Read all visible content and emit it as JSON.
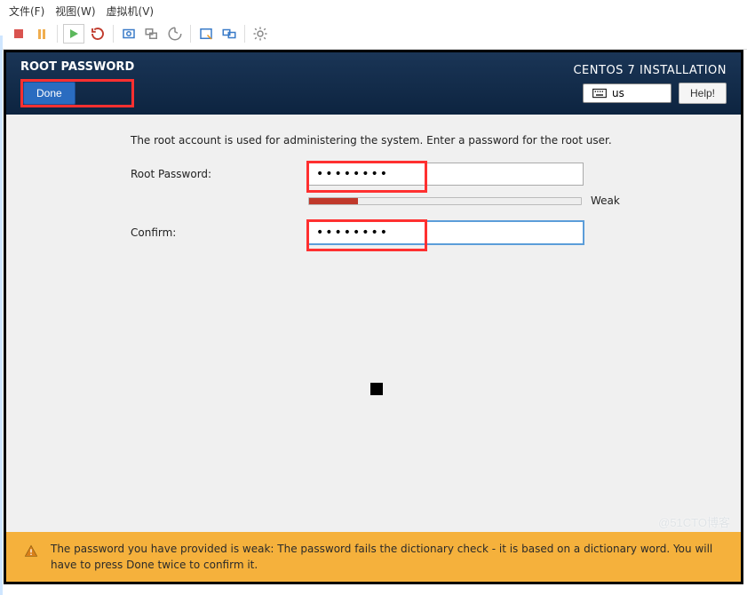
{
  "vm_menu": {
    "file": "文件(F)",
    "view": "视图(W)",
    "vm": "虚拟机(V)"
  },
  "header": {
    "page_title": "ROOT PASSWORD",
    "done": "Done",
    "installation_title": "CENTOS 7 INSTALLATION",
    "keyboard": "us",
    "help": "Help!"
  },
  "body": {
    "lead": "The root account is used for administering the system.  Enter a password for the root user.",
    "root_label": "Root Password:",
    "root_value": "••••••••",
    "confirm_label": "Confirm:",
    "confirm_value": "••••••••",
    "strength_label": "Weak"
  },
  "warning": "The password you have provided is weak: The password fails the dictionary check - it is based on a dictionary word. You will have to press Done twice to confirm it.",
  "watermark": "@51CTO博客"
}
